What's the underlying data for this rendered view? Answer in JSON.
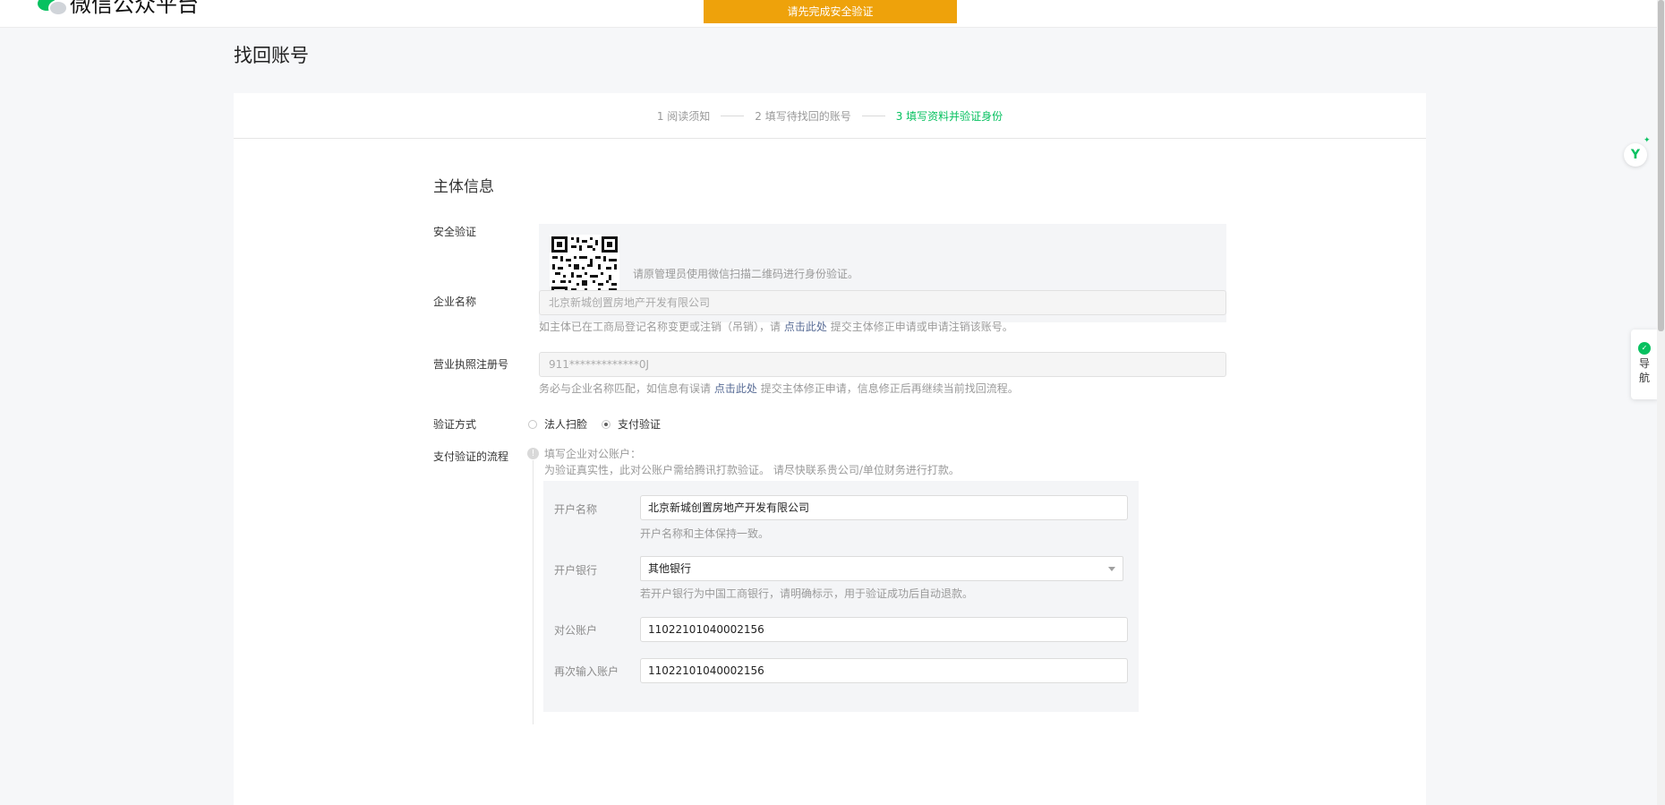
{
  "header": {
    "brand": "微信公众平台",
    "warning_banner": "请先完成安全验证"
  },
  "page": {
    "title": "找回账号"
  },
  "steps": [
    {
      "label": "1 阅读须知",
      "active": false
    },
    {
      "label": "2 填写待找回的账号",
      "active": false
    },
    {
      "label": "3 填写资料并验证身份",
      "active": true
    }
  ],
  "form": {
    "section_title": "主体信息",
    "security": {
      "label": "安全验证",
      "tip": "请原管理员使用微信扫描二维码进行身份验证。"
    },
    "company": {
      "label": "企业名称",
      "value": "北京新城创置房地产开发有限公司",
      "hint_before": "如主体已在工商局登记名称变更或注销（吊销），请",
      "hint_link": "点击此处",
      "hint_after": "提交主体修正申请或申请注销该账号。"
    },
    "license": {
      "label": "营业执照注册号",
      "value": "911*************0J",
      "hint_before": "务必与企业名称匹配，如信息有误请",
      "hint_link": "点击此处",
      "hint_after": "提交主体修正申请，信息修正后再继续当前找回流程。"
    },
    "verify_method": {
      "label": "验证方式",
      "options": [
        "法人扫脸",
        "支付验证"
      ],
      "selected": "支付验证"
    },
    "pay_flow": {
      "label": "支付验证的流程",
      "line1": "填写企业对公账户：",
      "line2": "为验证真实性，此对公账户需给腾讯打款验证。 请尽快联系贵公司/单位财务进行打款。",
      "account_name_label": "开户名称",
      "account_name_value": "北京新城创置房地产开发有限公司",
      "account_name_hint": "开户名称和主体保持一致。",
      "bank_label": "开户银行",
      "bank_value": "其他银行",
      "bank_hint": "若开户银行为中国工商银行，请明确标示，用于验证成功后自动退款。",
      "account_label": "对公账户",
      "account_value": "11022101040002156",
      "account_confirm_label": "再次输入账户",
      "account_confirm_value": "11022101040002156"
    }
  },
  "floating": {
    "helper_icon": "y-icon",
    "nav_label": "导航"
  }
}
